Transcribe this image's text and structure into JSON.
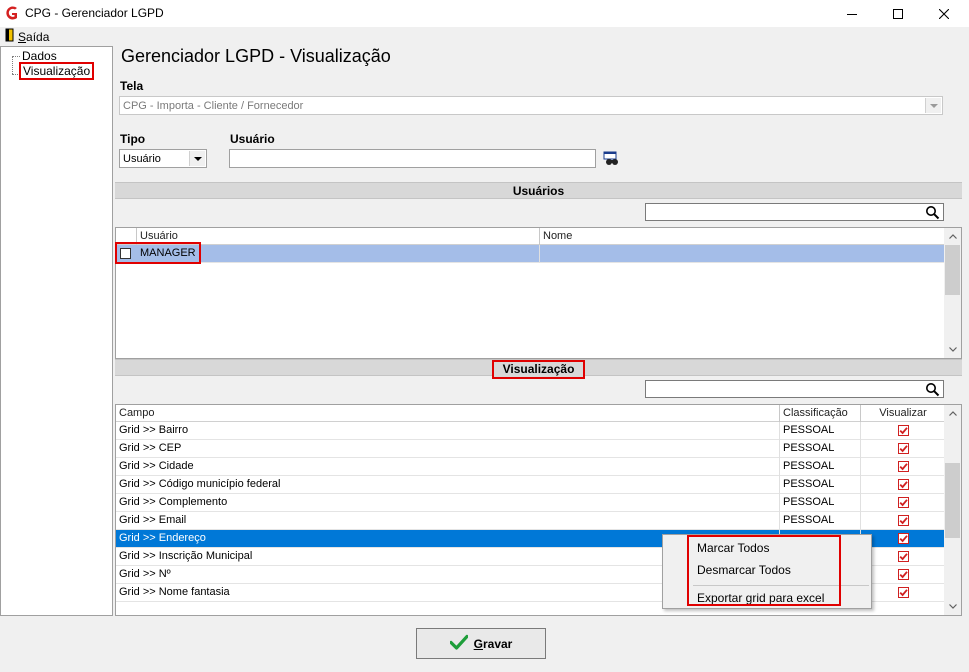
{
  "window": {
    "title": "CPG - Gerenciador LGPD"
  },
  "menu": {
    "exit_label": "Saída"
  },
  "tree": {
    "items": [
      {
        "label": "Dados"
      },
      {
        "label": "Visualização",
        "highlighted": true
      }
    ]
  },
  "page": {
    "title": "Gerenciador LGPD - Visualização"
  },
  "form": {
    "tela_label": "Tela",
    "tela_value": "CPG - Importa - Cliente / Fornecedor",
    "tipo_label": "Tipo",
    "tipo_value": "Usuário",
    "usuario_label": "Usuário",
    "usuario_value": ""
  },
  "users_section": {
    "header": "Usuários",
    "search_value": "",
    "columns": [
      "Usuário",
      "Nome"
    ],
    "rows": [
      {
        "usuario": "MANAGER",
        "nome": "",
        "checked": false
      }
    ]
  },
  "view_section": {
    "header": "Visualização",
    "search_value": "",
    "columns": [
      "Campo",
      "Classificação",
      "Visualizar"
    ],
    "rows": [
      {
        "campo": "Grid >> Bairro",
        "classificacao": "PESSOAL",
        "visualizar": true
      },
      {
        "campo": "Grid >> CEP",
        "classificacao": "PESSOAL",
        "visualizar": true
      },
      {
        "campo": "Grid >> Cidade",
        "classificacao": "PESSOAL",
        "visualizar": true
      },
      {
        "campo": "Grid >> Código município federal",
        "classificacao": "PESSOAL",
        "visualizar": true
      },
      {
        "campo": "Grid >> Complemento",
        "classificacao": "PESSOAL",
        "visualizar": true
      },
      {
        "campo": "Grid >> Email",
        "classificacao": "PESSOAL",
        "visualizar": true
      },
      {
        "campo": "Grid >> Endereço",
        "classificacao": "",
        "visualizar": true,
        "selected": true
      },
      {
        "campo": "Grid >> Inscrição Municipal",
        "classificacao": "",
        "visualizar": true
      },
      {
        "campo": "Grid >> Nº",
        "classificacao": "",
        "visualizar": true
      },
      {
        "campo": "Grid >> Nome fantasia",
        "classificacao": "",
        "visualizar": true
      }
    ]
  },
  "context_menu": {
    "items": [
      "Marcar Todos",
      "Desmarcar Todos",
      "Exportar grid para excel"
    ]
  },
  "buttons": {
    "save_label": "Gravar"
  },
  "colors": {
    "selection": "#0078d7",
    "highlight_box": "#e00000",
    "user_row": "#a4bde8",
    "check": "#d02020",
    "save_check": "#1e9e3a"
  }
}
